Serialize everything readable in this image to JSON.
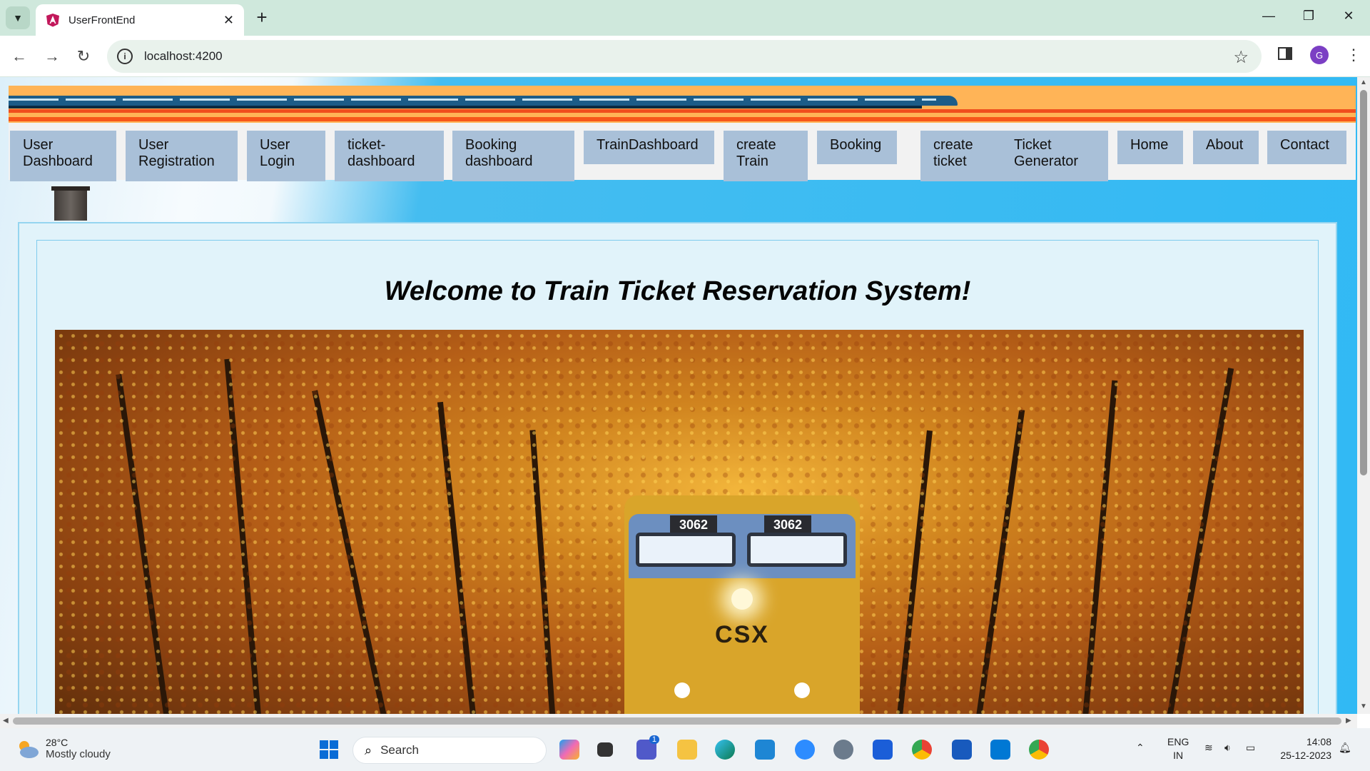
{
  "browser": {
    "tab_title": "UserFrontEnd",
    "url": "localhost:4200",
    "profile_initial": "G",
    "new_tab_symbol": "+",
    "tab_close_symbol": "✕"
  },
  "nav": {
    "items": [
      "User\nDashboard",
      "User\nRegistration",
      "User\nLogin",
      "ticket-\ndashboard",
      "Booking\ndashboard",
      "TrainDashboard",
      "create\nTrain",
      "Booking",
      "create\nticket",
      "Ticket\nGenerator",
      "Home",
      "About",
      "Contact"
    ]
  },
  "main": {
    "welcome_heading": "Welcome to Train Ticket Reservation System!",
    "locomotive_number_left": "3062",
    "locomotive_number_right": "3062",
    "locomotive_logo": "CSX"
  },
  "taskbar": {
    "weather_temp": "28°C",
    "weather_condition": "Mostly cloudy",
    "search_label": "Search",
    "teams_badge": "1",
    "language_line1": "ENG",
    "language_line2": "IN",
    "time": "14:08",
    "date": "25-12-2023"
  },
  "colors": {
    "nav_button": "#a9c0d8",
    "banner_orange": "#ffb457",
    "card_bg": "#e1f3fa",
    "page_blue": "#31b9f4"
  }
}
